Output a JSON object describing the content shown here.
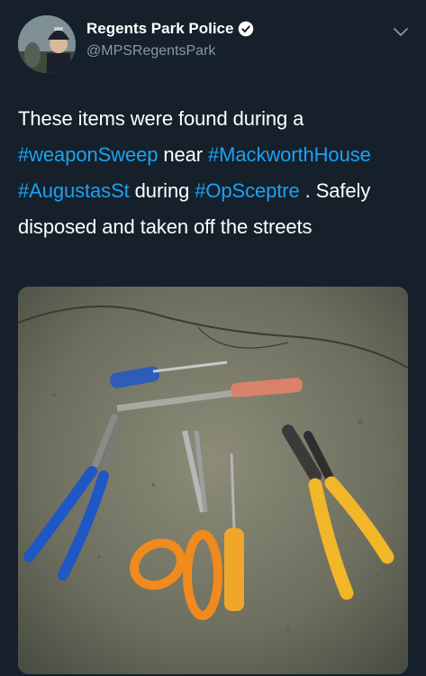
{
  "tweet": {
    "display_name": "Regents Park Police",
    "handle": "@MPSRegentsPark",
    "verified_icon": "verified-badge-icon",
    "menu_icon": "chevron-down-icon",
    "text": {
      "part1": "These items were found during a ",
      "hashtag1": "#weaponSweep",
      "part2": " near ",
      "hashtag2": "#MackworthHouse",
      "part3": " ",
      "hashtag3": "#AugustasSt",
      "part4": " during ",
      "hashtag4": "#OpSceptre",
      "part5": " . Safely disposed and taken off the streets"
    }
  },
  "colors": {
    "background": "#15202b",
    "hashtag": "#1da1f2",
    "handle": "#8899a6"
  }
}
